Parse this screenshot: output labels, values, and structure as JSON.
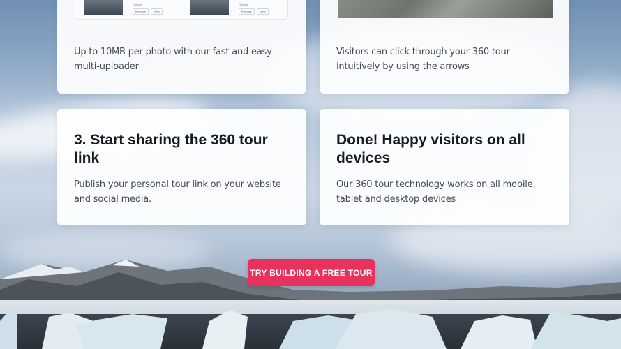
{
  "cards": {
    "uploader": {
      "description": "Up to 10MB per photo with our fast and easy multi-uploader",
      "preview": {
        "options_label": "Options",
        "remove_label": "Remove",
        "view_label": "View"
      }
    },
    "navigation": {
      "description": "Visitors can click through your 360 tour intuitively by using the arrows"
    },
    "sharing": {
      "title": "3. Start sharing the 360 tour link",
      "description": "Publish your personal tour link on your website and social media."
    },
    "devices": {
      "title": "Done! Happy visitors on all devices",
      "description": "Our 360 tour technology works on all mobile, tablet and desktop devices"
    }
  },
  "cta": {
    "label": "TRY BUILDING A FREE TOUR",
    "color": "#e8315d"
  }
}
